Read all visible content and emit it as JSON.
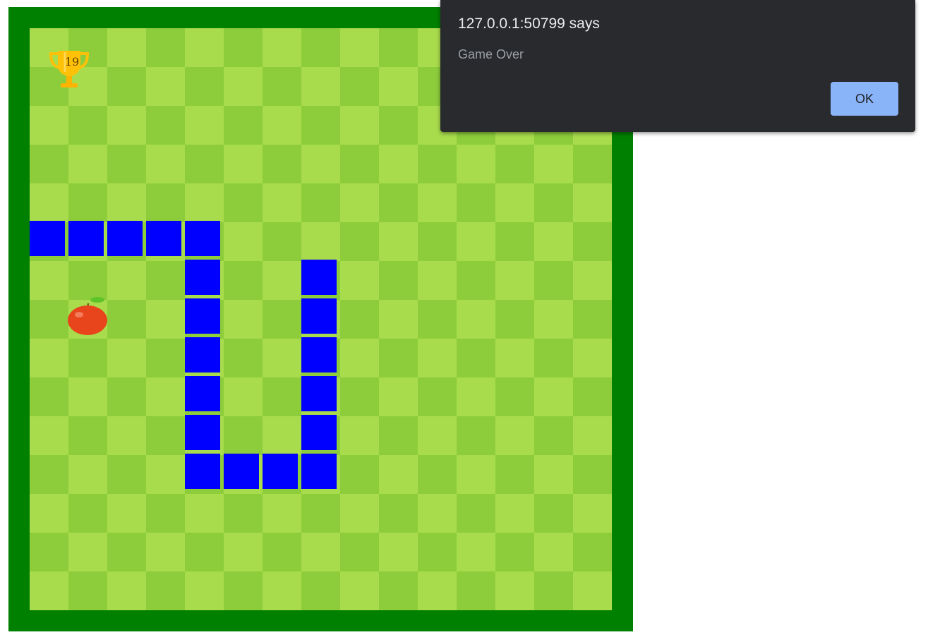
{
  "game": {
    "score": "19",
    "grid_size": 15,
    "colors": {
      "border": "#008000",
      "tile_light": "#a9dc4c",
      "tile_dark": "#8dcd3b",
      "snake": "#0000ff",
      "apple": "#e8451c",
      "trophy": "#ffc107"
    },
    "snake_cells": [
      [
        0,
        5
      ],
      [
        1,
        5
      ],
      [
        2,
        5
      ],
      [
        3,
        5
      ],
      [
        4,
        5
      ],
      [
        4,
        6
      ],
      [
        4,
        7
      ],
      [
        4,
        8
      ],
      [
        4,
        9
      ],
      [
        4,
        10
      ],
      [
        4,
        11
      ],
      [
        5,
        11
      ],
      [
        6,
        11
      ],
      [
        7,
        11
      ],
      [
        7,
        10
      ],
      [
        7,
        9
      ],
      [
        7,
        8
      ],
      [
        7,
        7
      ],
      [
        7,
        6
      ]
    ],
    "apple_cell": [
      1,
      7
    ]
  },
  "dialog": {
    "origin": "127.0.0.1:50799 says",
    "message": "Game Over",
    "ok_label": "OK"
  }
}
